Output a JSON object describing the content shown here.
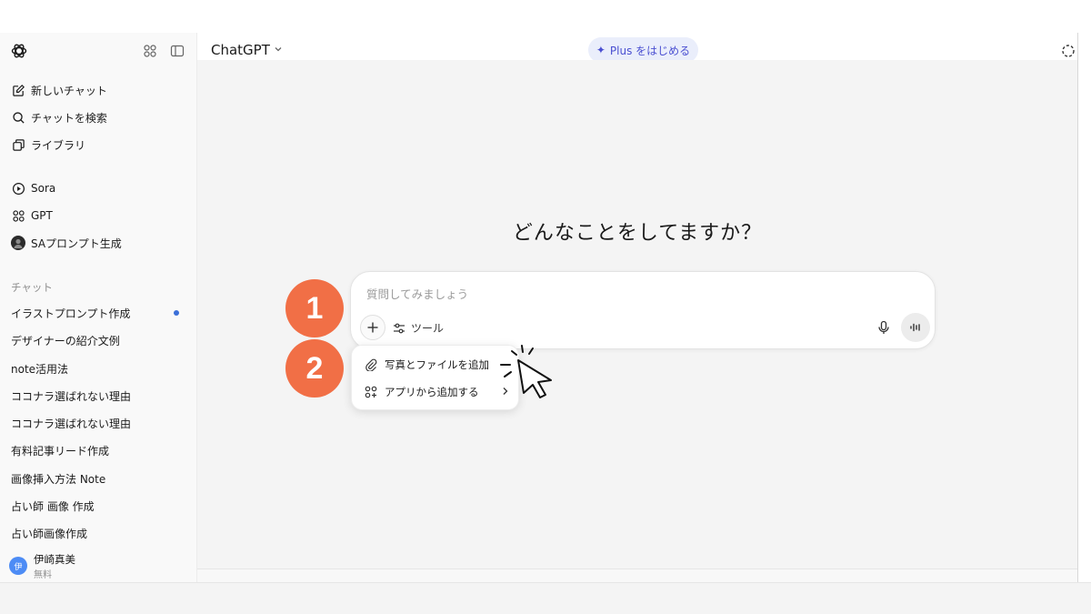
{
  "sidebar": {
    "nav": [
      {
        "label": "新しいチャット",
        "icon": "new-chat-icon"
      },
      {
        "label": "チャットを検索",
        "icon": "search-icon"
      },
      {
        "label": "ライブラリ",
        "icon": "library-icon"
      }
    ],
    "apps": [
      {
        "label": "Sora",
        "icon": "play-icon"
      },
      {
        "label": "GPT",
        "icon": "grid-icon"
      },
      {
        "label": "SAプロンプト生成",
        "icon": "gpt-avatar-icon"
      }
    ],
    "section_label": "チャット",
    "chats": [
      {
        "label": "イラストプロンプト作成"
      },
      {
        "label": "デザイナーの紹介文例"
      },
      {
        "label": "note活用法"
      },
      {
        "label": "ココナラ選ばれない理由"
      },
      {
        "label": "ココナラ選ばれない理由"
      },
      {
        "label": "有料記事リード作成"
      },
      {
        "label": "画像挿入方法 Note"
      },
      {
        "label": "占い師 画像 作成"
      },
      {
        "label": "占い師画像作成"
      }
    ],
    "user": {
      "avatar": "伊",
      "name": "伊崎真美",
      "plan": "無料"
    }
  },
  "header": {
    "model": "ChatGPT",
    "plus_button": "Plus をはじめる"
  },
  "main": {
    "heading": "どんなことをしてますか？",
    "composer": {
      "placeholder": "質問してみましょう",
      "tools_label": "ツール"
    },
    "menu": [
      {
        "label": "写真とファイルを追加",
        "icon": "paperclip-icon"
      },
      {
        "label": "アプリから追加する",
        "icon": "apps-icon"
      }
    ]
  },
  "annotations": {
    "badge_1": "1",
    "badge_2": "2"
  },
  "colors": {
    "accent_badge": "#f16f46",
    "plus_button_bg": "#eaeefb",
    "plus_button_text": "#4a4fd1",
    "unread_dot": "#3b6fd8"
  }
}
